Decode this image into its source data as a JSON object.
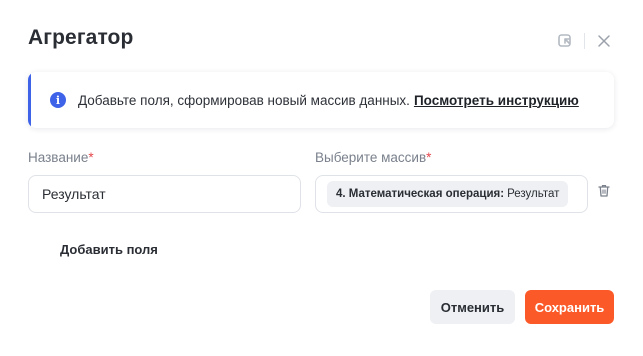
{
  "dialog": {
    "title": "Агрегатор"
  },
  "info": {
    "text": "Добавьте поля, сформировав новый массив данных.",
    "link": "Посмотреть инструкцию",
    "accent_color": "#3e63e8"
  },
  "form": {
    "name_label": "Название",
    "name_required": "*",
    "name_value": "Результат",
    "array_label": "Выберите массив",
    "array_required": "*",
    "array_chip_bold": "4. Математическая операция:",
    "array_chip_rest": "Результат"
  },
  "actions": {
    "add_fields": "Добавить поля",
    "cancel": "Отменить",
    "save": "Сохранить",
    "save_color": "#fb5a28"
  },
  "icons": {
    "minimize": "collapse-icon",
    "close": "close-icon",
    "info": "info-icon",
    "delete": "trash-icon"
  }
}
